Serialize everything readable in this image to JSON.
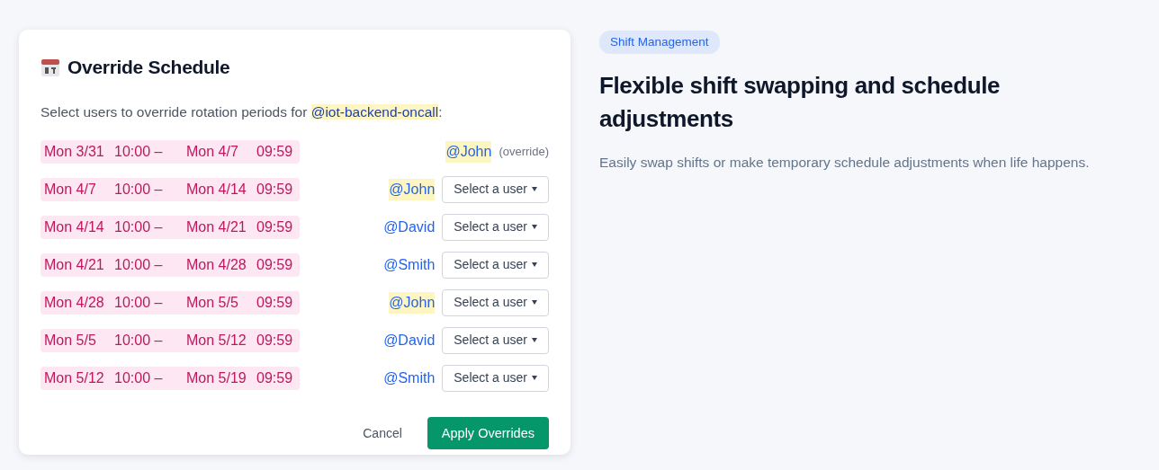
{
  "dialog": {
    "title": "Override Schedule",
    "intro": "Select users to override rotation periods for ",
    "team": "@iot-backend-oncall",
    "intro_end": ":",
    "periods": [
      {
        "start_date": "Mon 3/31",
        "start_time": "10:00 –",
        "end_date": "Mon 4/7",
        "end_time": "09:59",
        "user": "@John",
        "highlighted": true,
        "kind": "override",
        "note": "(override)"
      },
      {
        "start_date": "Mon 4/7",
        "start_time": "10:00 –",
        "end_date": "Mon 4/14",
        "end_time": "09:59",
        "user": "@John",
        "highlighted": true,
        "kind": "select",
        "select": "Select a user"
      },
      {
        "start_date": "Mon 4/14",
        "start_time": "10:00 –",
        "end_date": "Mon 4/21",
        "end_time": "09:59",
        "user": "@David",
        "highlighted": false,
        "kind": "select",
        "select": "Select a user"
      },
      {
        "start_date": "Mon 4/21",
        "start_time": "10:00 –",
        "end_date": "Mon 4/28",
        "end_time": "09:59",
        "user": "@Smith",
        "highlighted": false,
        "kind": "select",
        "select": "Select a user"
      },
      {
        "start_date": "Mon 4/28",
        "start_time": "10:00 –",
        "end_date": "Mon 5/5",
        "end_time": "09:59",
        "user": "@John",
        "highlighted": true,
        "kind": "select",
        "select": "Select a user"
      },
      {
        "start_date": "Mon 5/5",
        "start_time": "10:00 –",
        "end_date": "Mon 5/12",
        "end_time": "09:59",
        "user": "@David",
        "highlighted": false,
        "kind": "select",
        "select": "Select a user"
      },
      {
        "start_date": "Mon 5/12",
        "start_time": "10:00 –",
        "end_date": "Mon 5/19",
        "end_time": "09:59",
        "user": "@Smith",
        "highlighted": false,
        "kind": "select",
        "select": "Select a user"
      }
    ],
    "buttons": {
      "cancel": "Cancel",
      "apply": "Apply Overrides"
    }
  },
  "feature": {
    "tag": "Shift Management",
    "heading": "Flexible shift swapping and schedule adjustments",
    "description": "Easily swap shifts or make temporary schedule adjustments when life happens."
  }
}
